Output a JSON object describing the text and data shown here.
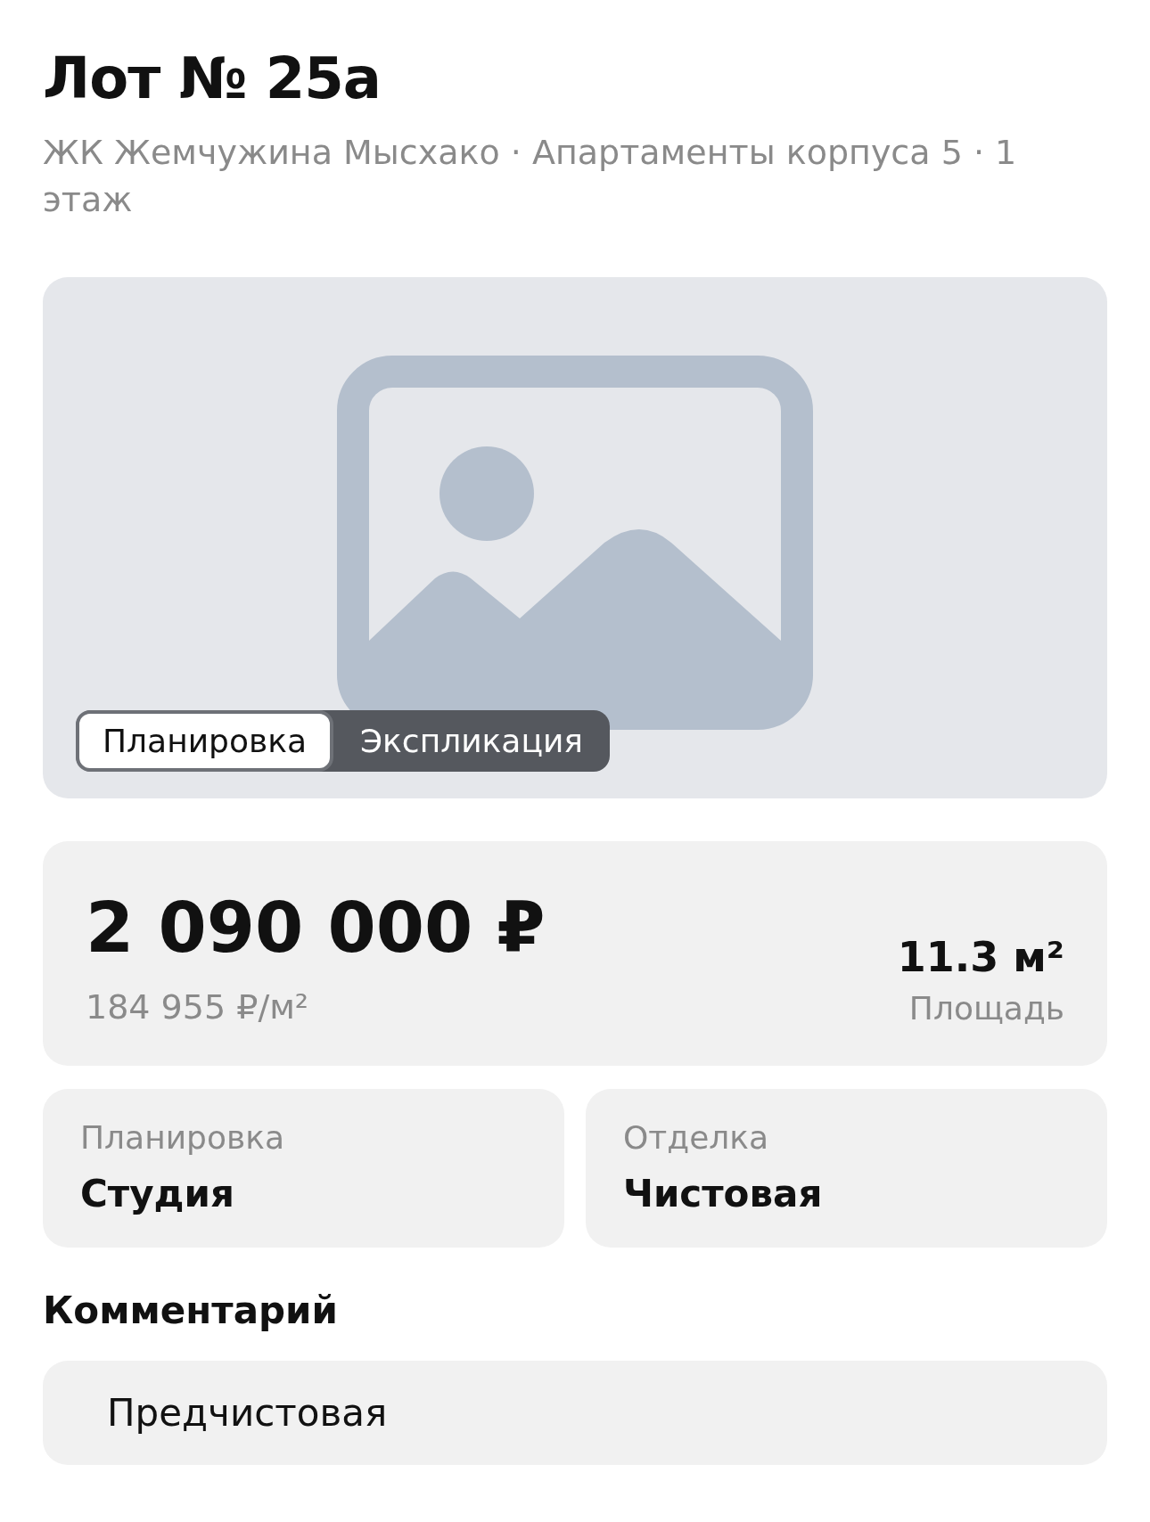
{
  "title": "Лот № 25а",
  "subtitle": "ЖК Жемчужина Мысхако · Апартаменты корпуса 5 · 1 этаж",
  "gallery": {
    "tabs": [
      {
        "label": "Планировка",
        "selected": true
      },
      {
        "label": "Экспликация",
        "selected": false
      }
    ]
  },
  "price": {
    "amount": "2 090 000 ₽",
    "per_meter": "184 955 ₽/м²",
    "area": "11.3 м²",
    "area_label": "Площадь"
  },
  "details": [
    {
      "label": "Планировка",
      "value": "Студия"
    },
    {
      "label": "Отделка",
      "value": "Чистовая"
    }
  ],
  "comment": {
    "heading": "Комментарий",
    "text": "Предчистовая"
  }
}
